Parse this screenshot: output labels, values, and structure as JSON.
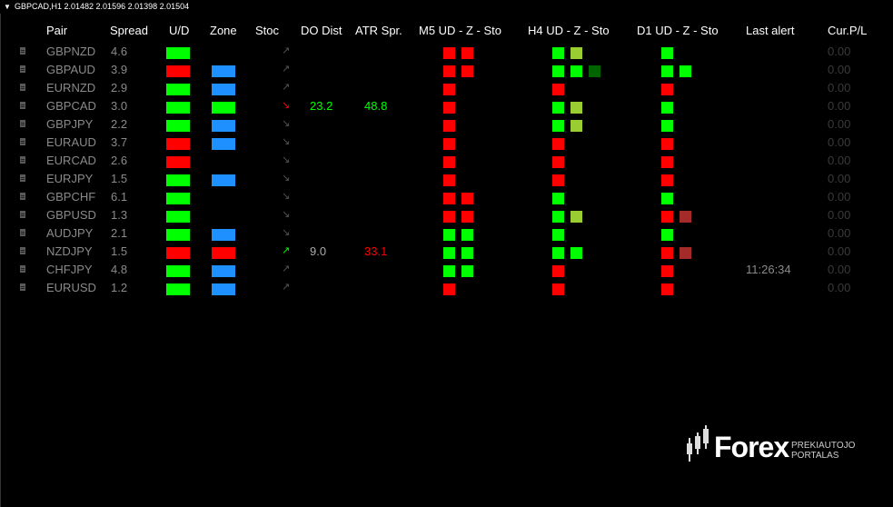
{
  "topbar": {
    "symbol_line": "GBPCAD,H1  2.01482 2.01596 2.01398 2.01504"
  },
  "headers": {
    "pair": "Pair",
    "spread": "Spread",
    "ud": "U/D",
    "zone": "Zone",
    "stoc": "Stoc",
    "do_dist": "DO Dist",
    "atr_spr": "ATR Spr.",
    "m5": "M5 UD - Z - Sto",
    "h4": "H4 UD - Z - Sto",
    "d1": "D1 UD - Z - Sto",
    "last_alert": "Last alert",
    "cur_pl": "Cur.P/L"
  },
  "colors": {
    "green": "#00ff00",
    "red": "#ff0000",
    "blue": "#1e90ff",
    "olive": "#9acd32",
    "darkgreen": "#006400",
    "darkred": "#a52a2a",
    "muted": "#8a8a8a",
    "dim": "#3a3a3a"
  },
  "rows": [
    {
      "pair": "GBPNZD",
      "spread": "4.6",
      "ud": "green",
      "zone": "",
      "stoc": "up",
      "stoc_color": "#555555",
      "do_dist": "",
      "do_color": "",
      "atr": "",
      "atr_color": "",
      "m5": [
        "red",
        "red"
      ],
      "h4": [
        "green",
        "olive"
      ],
      "d1": [
        "green"
      ],
      "last_alert": "",
      "cur_pl": "0.00"
    },
    {
      "pair": "GBPAUD",
      "spread": "3.9",
      "ud": "red",
      "zone": "blue",
      "stoc": "up",
      "stoc_color": "#555555",
      "do_dist": "",
      "do_color": "",
      "atr": "",
      "atr_color": "",
      "m5": [
        "red",
        "red"
      ],
      "h4": [
        "green",
        "green",
        "darkgreen"
      ],
      "d1": [
        "green",
        "green"
      ],
      "last_alert": "",
      "cur_pl": "0.00"
    },
    {
      "pair": "EURNZD",
      "spread": "2.9",
      "ud": "green",
      "zone": "blue",
      "stoc": "up",
      "stoc_color": "#555555",
      "do_dist": "",
      "do_color": "",
      "atr": "",
      "atr_color": "",
      "m5": [
        "red"
      ],
      "h4": [
        "red"
      ],
      "d1": [
        "red"
      ],
      "last_alert": "",
      "cur_pl": "0.00"
    },
    {
      "pair": "GBPCAD",
      "spread": "3.0",
      "ud": "green",
      "zone": "green",
      "stoc": "down",
      "stoc_color": "#ff0000",
      "do_dist": "23.2",
      "do_color": "#00ff00",
      "atr": "48.8",
      "atr_color": "#00ff00",
      "m5": [
        "red"
      ],
      "h4": [
        "green",
        "olive"
      ],
      "d1": [
        "green"
      ],
      "last_alert": "",
      "cur_pl": "0.00"
    },
    {
      "pair": "GBPJPY",
      "spread": "2.2",
      "ud": "green",
      "zone": "blue",
      "stoc": "down",
      "stoc_color": "#555555",
      "do_dist": "",
      "do_color": "",
      "atr": "",
      "atr_color": "",
      "m5": [
        "red"
      ],
      "h4": [
        "green",
        "olive"
      ],
      "d1": [
        "green"
      ],
      "last_alert": "",
      "cur_pl": "0.00"
    },
    {
      "pair": "EURAUD",
      "spread": "3.7",
      "ud": "red",
      "zone": "blue",
      "stoc": "down",
      "stoc_color": "#555555",
      "do_dist": "",
      "do_color": "",
      "atr": "",
      "atr_color": "",
      "m5": [
        "red"
      ],
      "h4": [
        "red"
      ],
      "d1": [
        "red"
      ],
      "last_alert": "",
      "cur_pl": "0.00"
    },
    {
      "pair": "EURCAD",
      "spread": "2.6",
      "ud": "red",
      "zone": "",
      "stoc": "down",
      "stoc_color": "#555555",
      "do_dist": "",
      "do_color": "",
      "atr": "",
      "atr_color": "",
      "m5": [
        "red"
      ],
      "h4": [
        "red"
      ],
      "d1": [
        "red"
      ],
      "last_alert": "",
      "cur_pl": "0.00"
    },
    {
      "pair": "EURJPY",
      "spread": "1.5",
      "ud": "green",
      "zone": "blue",
      "stoc": "down",
      "stoc_color": "#555555",
      "do_dist": "",
      "do_color": "",
      "atr": "",
      "atr_color": "",
      "m5": [
        "red"
      ],
      "h4": [
        "red"
      ],
      "d1": [
        "red"
      ],
      "last_alert": "",
      "cur_pl": "0.00"
    },
    {
      "pair": "GBPCHF",
      "spread": "6.1",
      "ud": "green",
      "zone": "",
      "stoc": "down",
      "stoc_color": "#555555",
      "do_dist": "",
      "do_color": "",
      "atr": "",
      "atr_color": "",
      "m5": [
        "red",
        "red"
      ],
      "h4": [
        "green"
      ],
      "d1": [
        "green"
      ],
      "last_alert": "",
      "cur_pl": "0.00"
    },
    {
      "pair": "GBPUSD",
      "spread": "1.3",
      "ud": "green",
      "zone": "",
      "stoc": "down",
      "stoc_color": "#555555",
      "do_dist": "",
      "do_color": "",
      "atr": "",
      "atr_color": "",
      "m5": [
        "red",
        "red"
      ],
      "h4": [
        "green",
        "olive"
      ],
      "d1": [
        "red",
        "darkred"
      ],
      "last_alert": "",
      "cur_pl": "0.00"
    },
    {
      "pair": "AUDJPY",
      "spread": "2.1",
      "ud": "green",
      "zone": "blue",
      "stoc": "down",
      "stoc_color": "#555555",
      "do_dist": "",
      "do_color": "",
      "atr": "",
      "atr_color": "",
      "m5": [
        "green",
        "green"
      ],
      "h4": [
        "green"
      ],
      "d1": [
        "green"
      ],
      "last_alert": "",
      "cur_pl": "0.00"
    },
    {
      "pair": "NZDJPY",
      "spread": "1.5",
      "ud": "red",
      "zone": "red",
      "stoc": "up",
      "stoc_color": "#00ff00",
      "do_dist": "9.0",
      "do_color": "#aaaaaa",
      "atr": "33.1",
      "atr_color": "#ff0000",
      "m5": [
        "green",
        "green"
      ],
      "h4": [
        "green",
        "green"
      ],
      "d1": [
        "red",
        "darkred"
      ],
      "last_alert": "",
      "cur_pl": "0.00"
    },
    {
      "pair": "CHFJPY",
      "spread": "4.8",
      "ud": "green",
      "zone": "blue",
      "stoc": "up",
      "stoc_color": "#555555",
      "do_dist": "",
      "do_color": "",
      "atr": "",
      "atr_color": "",
      "m5": [
        "green",
        "green"
      ],
      "h4": [
        "red"
      ],
      "d1": [
        "red"
      ],
      "last_alert": "11:26:34",
      "cur_pl": "0.00"
    },
    {
      "pair": "EURUSD",
      "spread": "1.2",
      "ud": "green",
      "zone": "blue",
      "stoc": "up",
      "stoc_color": "#555555",
      "do_dist": "",
      "do_color": "",
      "atr": "",
      "atr_color": "",
      "m5": [
        "red"
      ],
      "h4": [
        "red"
      ],
      "d1": [
        "red"
      ],
      "last_alert": "",
      "cur_pl": "0.00"
    }
  ],
  "logo": {
    "brand": "Forex",
    "sub_line1": "PREKIAUTOJO",
    "sub_line2": "PORTALAS"
  }
}
